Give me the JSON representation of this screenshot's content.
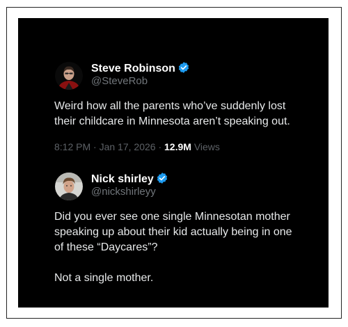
{
  "colors": {
    "card_background": "#000000",
    "verified_badge": "#1d9bf0",
    "handle_text": "#71767b",
    "body_text": "#e7e9ea"
  },
  "tweet1": {
    "avatar_icon": "profile-photo",
    "display_name": "Steve Robinson",
    "verified": true,
    "handle": "@SteveRob",
    "text_line1": "Weird how all the parents who’ve suddenly lost",
    "text_line2": "their childcare in Minnesota aren’t speaking out.",
    "time": "8:12 PM",
    "separator1": "·",
    "date": "Jan 17, 2026",
    "separator2": "·",
    "views_count": "12.9M",
    "views_label": "Views"
  },
  "tweet2": {
    "avatar_icon": "profile-photo",
    "display_name": "Nick shirley",
    "verified": true,
    "handle": "@nickshirleyy",
    "text_line1": "Did you ever see one single Minnesotan mother",
    "text_line2": "speaking up about their kid actually being in one",
    "text_line3": "of these “Daycares”?",
    "text_line4": "Not a single mother."
  }
}
